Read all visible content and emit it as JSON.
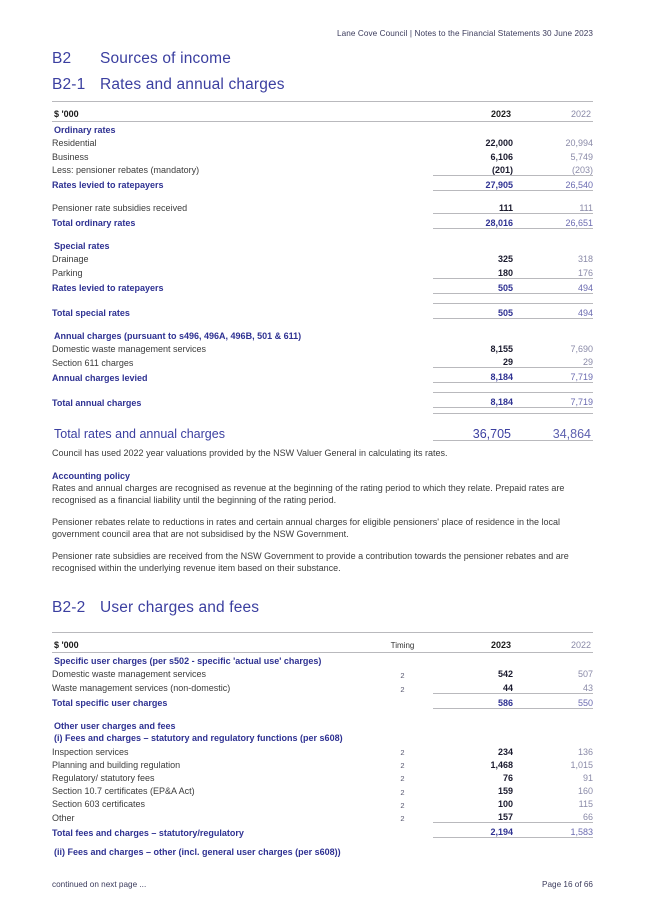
{
  "running_header": "Lane Cove Council | Notes to the Financial Statements 30 June 2023",
  "notes": {
    "b2": {
      "number": "B2",
      "title": "Sources of income"
    },
    "b2_1": {
      "number": "B2-1",
      "title": "Rates and annual charges"
    },
    "b2_2": {
      "number": "B2-2",
      "title": "User charges and fees"
    }
  },
  "table_rates": {
    "headers": {
      "unit": "$ '000",
      "timing": "",
      "year_current": "2023",
      "year_prior": "2022"
    },
    "rows": [
      {
        "kind": "section",
        "label": "Ordinary rates"
      },
      {
        "kind": "item",
        "label": "Residential",
        "timing": "",
        "v2023": "22,000",
        "v2022": "20,994"
      },
      {
        "kind": "item",
        "label": "Business",
        "timing": "",
        "v2023": "6,106",
        "v2022": "5,749"
      },
      {
        "kind": "item-ruled",
        "label": "Less: pensioner rebates (mandatory)",
        "timing": "",
        "v2023": "(201)",
        "v2022": "(203)"
      },
      {
        "kind": "subtotal",
        "label": "Rates levied to ratepayers",
        "timing": "",
        "v2023": "27,905",
        "v2022": "26,540"
      },
      {
        "kind": "gap"
      },
      {
        "kind": "item-ruled",
        "label": "Pensioner rate subsidies received",
        "timing": "",
        "v2023": "111",
        "v2022": "111"
      },
      {
        "kind": "subtotal",
        "label": "Total ordinary rates",
        "timing": "",
        "v2023": "28,016",
        "v2022": "26,651"
      },
      {
        "kind": "gap"
      },
      {
        "kind": "section",
        "label": "Special rates"
      },
      {
        "kind": "item",
        "label": "Drainage",
        "timing": "",
        "v2023": "325",
        "v2022": "318"
      },
      {
        "kind": "item-ruled",
        "label": "Parking",
        "timing": "",
        "v2023": "180",
        "v2022": "176"
      },
      {
        "kind": "subtotal",
        "label": "Rates levied to ratepayers",
        "timing": "",
        "v2023": "505",
        "v2022": "494"
      },
      {
        "kind": "gap"
      },
      {
        "kind": "subtotal",
        "label": "Total special rates",
        "timing": "",
        "v2023": "505",
        "v2022": "494"
      },
      {
        "kind": "gap"
      },
      {
        "kind": "section",
        "label": "Annual charges (pursuant to s496, 496A, 496B, 501 & 611)"
      },
      {
        "kind": "item",
        "label": "Domestic waste management services",
        "timing": "",
        "v2023": "8,155",
        "v2022": "7,690"
      },
      {
        "kind": "item-ruled",
        "label": "Section 611 charges",
        "timing": "",
        "v2023": "29",
        "v2022": "29"
      },
      {
        "kind": "subtotal",
        "label": "Annual charges levied",
        "timing": "",
        "v2023": "8,184",
        "v2022": "7,719"
      },
      {
        "kind": "gap"
      },
      {
        "kind": "subtotal",
        "label": "Total annual charges",
        "timing": "",
        "v2023": "8,184",
        "v2022": "7,719"
      },
      {
        "kind": "gap-sm"
      },
      {
        "kind": "grand",
        "label": "Total rates and annual charges",
        "timing": "",
        "v2023": "36,705",
        "v2022": "34,864"
      }
    ]
  },
  "prose": {
    "valuation": "Council has used 2022 year valuations provided by the NSW Valuer General in calculating its rates.",
    "accounting_policy_heading": "Accounting policy",
    "policy_1": "Rates and annual charges are recognised as revenue at the beginning of the rating period to which they relate. Prepaid rates are recognised as a financial liability until the beginning of the rating period.",
    "policy_2": "Pensioner rebates relate to reductions in rates and certain annual charges for eligible pensioners' place of residence in the local government council area that are not subsidised by the NSW Government.",
    "policy_3": "Pensioner rate subsidies are received from the NSW Government to provide a contribution towards the pensioner rebates and are recognised within the underlying revenue item based on their substance."
  },
  "table_user": {
    "headers": {
      "unit": "$ '000",
      "timing": "Timing",
      "year_current": "2023",
      "year_prior": "2022"
    },
    "rows": [
      {
        "kind": "section",
        "label": "Specific user charges (per s502 - specific 'actual use' charges)"
      },
      {
        "kind": "item",
        "label": "Domestic waste management services",
        "timing": "2",
        "v2023": "542",
        "v2022": "507"
      },
      {
        "kind": "item-ruled",
        "label": "Waste management services (non-domestic)",
        "timing": "2",
        "v2023": "44",
        "v2022": "43"
      },
      {
        "kind": "subtotal",
        "label": "Total specific user charges",
        "timing": "",
        "v2023": "586",
        "v2022": "550"
      },
      {
        "kind": "gap"
      },
      {
        "kind": "section",
        "label": "Other user charges and fees"
      },
      {
        "kind": "section-tight",
        "label": "(i) Fees and charges – statutory and regulatory functions (per s608)"
      },
      {
        "kind": "item",
        "label": "Inspection services",
        "timing": "2",
        "v2023": "234",
        "v2022": "136"
      },
      {
        "kind": "item",
        "label": "Planning and building regulation",
        "timing": "2",
        "v2023": "1,468",
        "v2022": "1,015"
      },
      {
        "kind": "item",
        "label": "Regulatory/ statutory fees",
        "timing": "2",
        "v2023": "76",
        "v2022": "91"
      },
      {
        "kind": "item",
        "label": "Section 10.7 certificates (EP&A Act)",
        "timing": "2",
        "v2023": "159",
        "v2022": "160"
      },
      {
        "kind": "item",
        "label": "Section 603 certificates",
        "timing": "2",
        "v2023": "100",
        "v2022": "115"
      },
      {
        "kind": "item-ruled",
        "label": "Other",
        "timing": "2",
        "v2023": "157",
        "v2022": "66"
      },
      {
        "kind": "subtotal-open",
        "label": "Total fees and charges – statutory/regulatory",
        "timing": "",
        "v2023": "2,194",
        "v2022": "1,583"
      },
      {
        "kind": "gap-sm"
      },
      {
        "kind": "section",
        "label": "(ii) Fees and charges – other (incl. general user charges (per s608))"
      }
    ]
  },
  "footer": {
    "continued": "continued on next page ...",
    "page": "Page 16 of 66"
  },
  "colors": {
    "brand_blue": "#2e3192",
    "heading_blue": "#3b3fa0",
    "prior_year_grey": "#8a8aa8",
    "rule_grey": "#b9b9bd"
  }
}
